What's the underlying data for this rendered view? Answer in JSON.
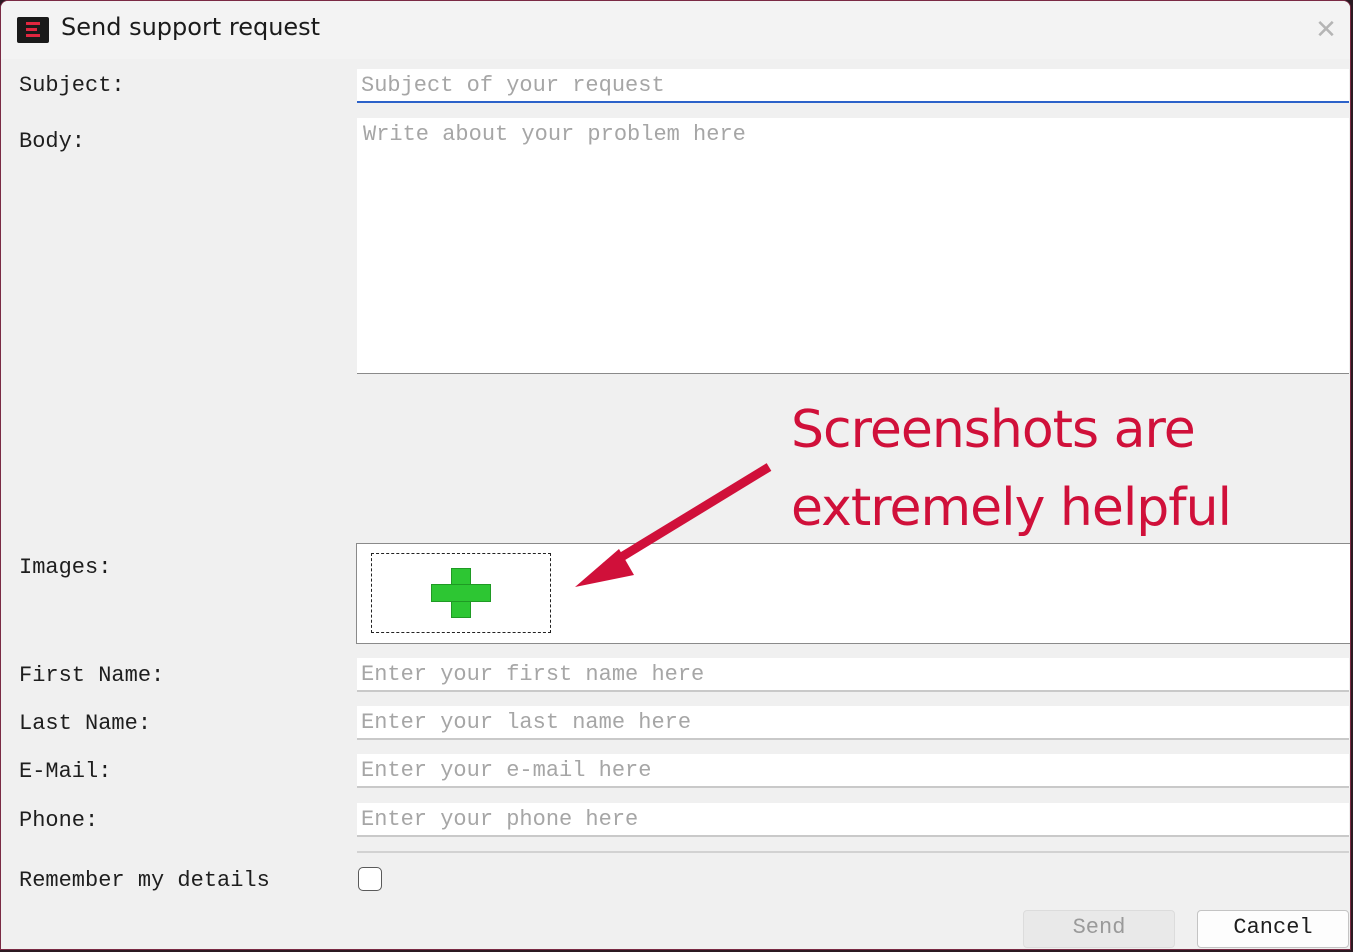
{
  "window": {
    "title": "Send support request",
    "close_glyph": "✕",
    "app_icon": "app-logo-icon",
    "accent_color": "#e0263f"
  },
  "form": {
    "subject": {
      "label": "Subject:",
      "placeholder": "Subject of your request",
      "value": ""
    },
    "body": {
      "label": "Body:",
      "placeholder": "Write about your problem here",
      "value": ""
    },
    "images": {
      "label": "Images:",
      "add_icon": "plus-icon",
      "add_icon_color": "#2dc633"
    },
    "first_name": {
      "label": "First Name:",
      "placeholder": "Enter your first name here",
      "value": ""
    },
    "last_name": {
      "label": "Last Name:",
      "placeholder": "Enter your last name here",
      "value": ""
    },
    "email": {
      "label": "E-Mail:",
      "placeholder": "Enter your e-mail here",
      "value": ""
    },
    "phone": {
      "label": "Phone:",
      "placeholder": "Enter your phone here",
      "value": ""
    },
    "remember": {
      "label": "Remember my details",
      "checked": false
    }
  },
  "buttons": {
    "send": "Send",
    "cancel": "Cancel"
  },
  "annotation": {
    "line1": "Screenshots are",
    "line2": "extremely helpful",
    "color": "#d0103a"
  }
}
